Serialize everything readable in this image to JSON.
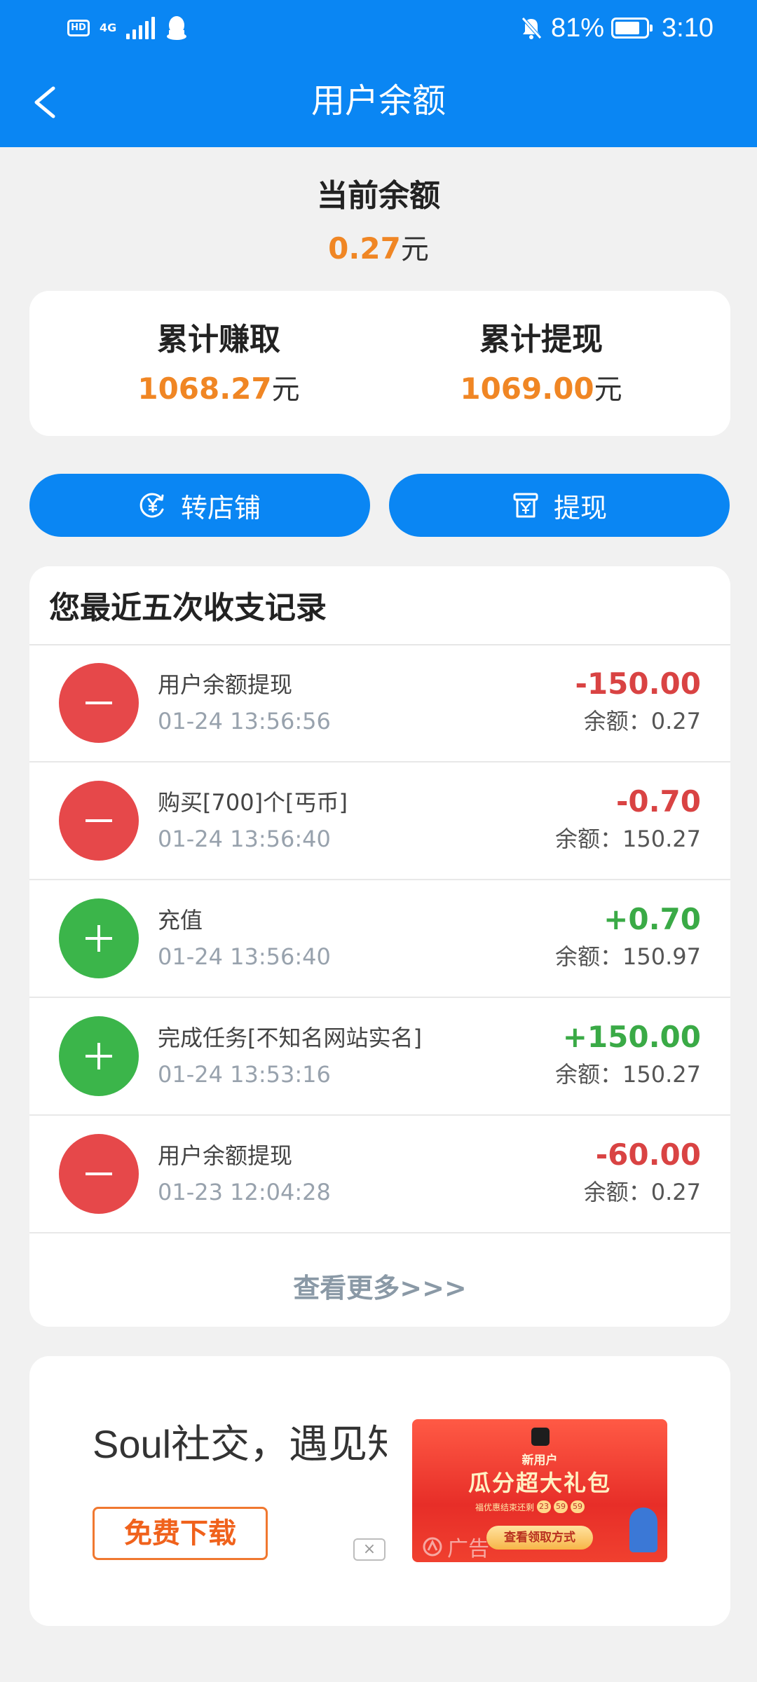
{
  "status_bar": {
    "hd": "HD",
    "network": "4G",
    "battery": "81%",
    "battery_level": 0.81,
    "time": "3:10"
  },
  "nav": {
    "title": "用户余额"
  },
  "balance": {
    "label": "当前余额",
    "amount": "0.27",
    "unit": "元"
  },
  "totals": {
    "earned_label": "累计赚取",
    "earned_value": "1068.27",
    "withdrawn_label": "累计提现",
    "withdrawn_value": "1069.00",
    "unit": "元"
  },
  "actions": {
    "transfer_label": "转店铺",
    "withdraw_label": "提现"
  },
  "records": {
    "title": "您最近五次收支记录",
    "items": [
      {
        "type": "out",
        "desc": "用户余额提现",
        "time": "01-24 13:56:56",
        "amount": "-150.00",
        "balance": "余额：0.27"
      },
      {
        "type": "out",
        "desc": "购买[700]个[丐币]",
        "time": "01-24 13:56:40",
        "amount": "-0.70",
        "balance": "余额：150.27"
      },
      {
        "type": "in",
        "desc": "充值",
        "time": "01-24 13:56:40",
        "amount": "+0.70",
        "balance": "余额：150.97"
      },
      {
        "type": "in",
        "desc": "完成任务[不知名网站实名]",
        "time": "01-24 13:53:16",
        "amount": "+150.00",
        "balance": "余额：150.27"
      },
      {
        "type": "out",
        "desc": "用户余额提现",
        "time": "01-23 12:04:28",
        "amount": "-60.00",
        "balance": "余额：0.27"
      }
    ],
    "view_more": "查看更多>>>"
  },
  "ad": {
    "text": "Soul社交，遇见知己，找到朋友",
    "download_label": "免费下载",
    "close_label": "×",
    "ad_label": "广告",
    "image": {
      "new_user": "新用户",
      "headline": "瓜分超大礼包",
      "countdown_text": "福优惠结束还剩",
      "countdown": [
        "23",
        "59",
        "59"
      ],
      "claim_label": "查看领取方式"
    }
  },
  "colors": {
    "primary": "#0a86f3",
    "orange": "#f08624",
    "red": "#e6484a",
    "green": "#3bb54a",
    "background": "#f1f1f1"
  }
}
